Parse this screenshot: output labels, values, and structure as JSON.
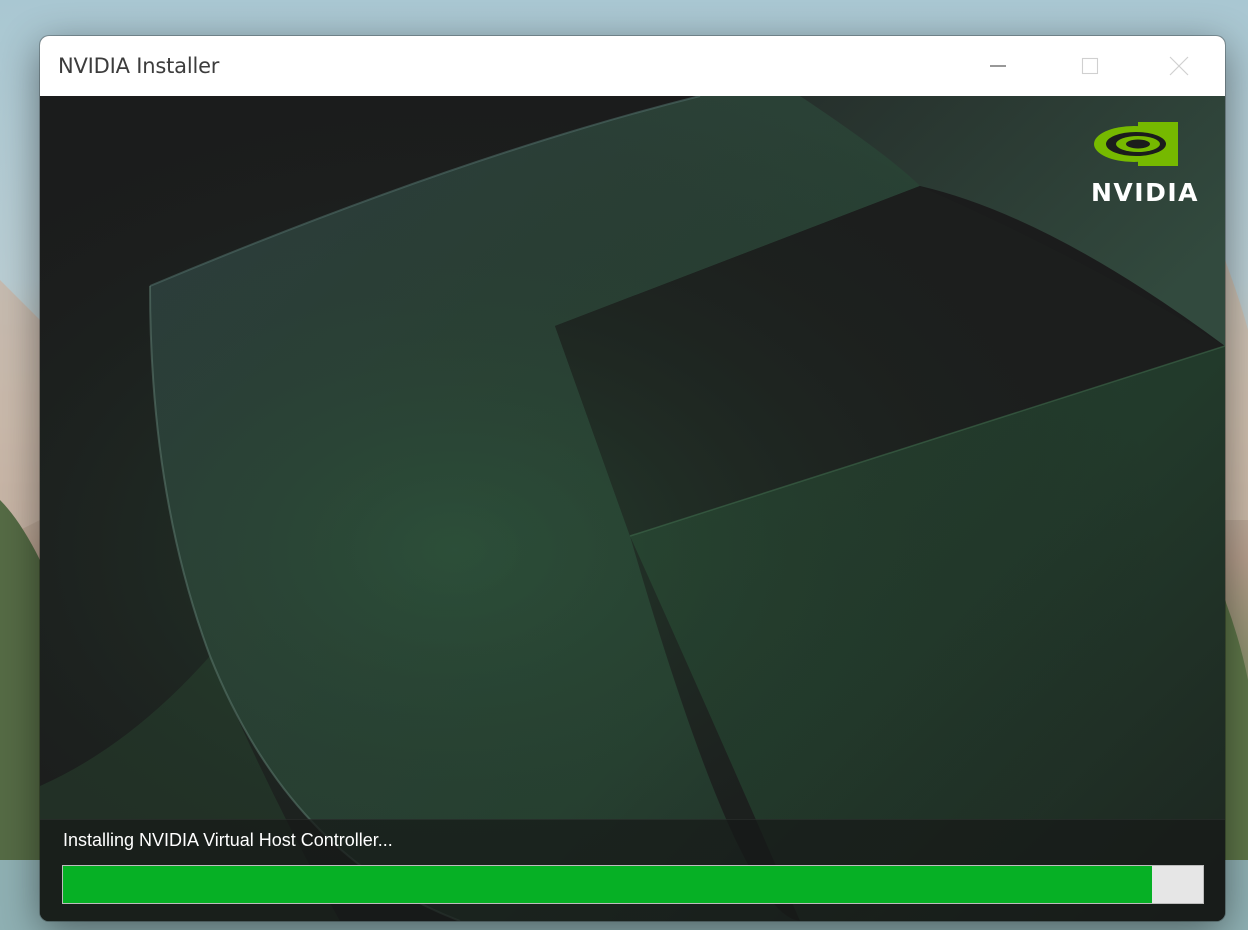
{
  "window": {
    "title": "NVIDIA Installer",
    "controls": {
      "minimize": "minimize-icon",
      "maximize": "maximize-icon",
      "close": "close-icon"
    }
  },
  "brand": {
    "logo_icon": "nvidia-eye-icon",
    "wordmark": "NVIDIA",
    "accent_color": "#76b900"
  },
  "install": {
    "status_text": "Installing NVIDIA Virtual Host Controller...",
    "progress": 0.955,
    "progress_color": "#06b025"
  }
}
